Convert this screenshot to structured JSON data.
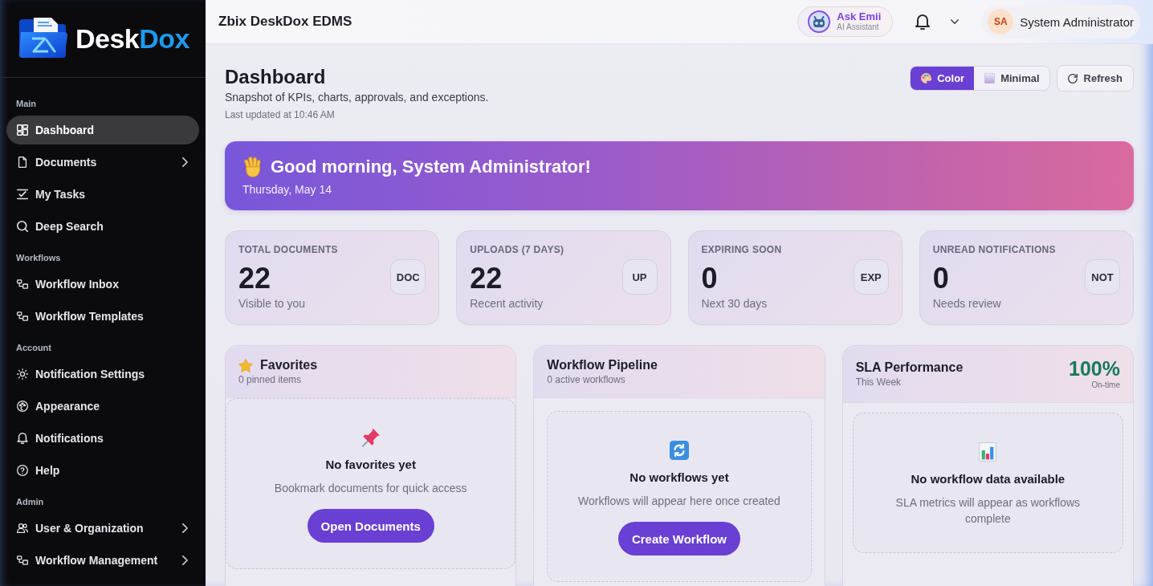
{
  "sidebar": {
    "brand": {
      "primary": "Desk",
      "accent": "Dox"
    },
    "sections": [
      {
        "label": "Main",
        "items": [
          {
            "label": "Dashboard",
            "selected": true,
            "expandable": false
          },
          {
            "label": "Documents",
            "selected": false,
            "expandable": true
          },
          {
            "label": "My Tasks",
            "selected": false,
            "expandable": false
          },
          {
            "label": "Deep Search",
            "selected": false,
            "expandable": false
          }
        ]
      },
      {
        "label": "Workflows",
        "items": [
          {
            "label": "Workflow Inbox",
            "selected": false,
            "expandable": false
          },
          {
            "label": "Workflow Templates",
            "selected": false,
            "expandable": false
          }
        ]
      },
      {
        "label": "Account",
        "items": [
          {
            "label": "Notification Settings",
            "selected": false,
            "expandable": false
          },
          {
            "label": "Appearance",
            "selected": false,
            "expandable": false
          },
          {
            "label": "Notifications",
            "selected": false,
            "expandable": false
          },
          {
            "label": "Help",
            "selected": false,
            "expandable": false
          }
        ]
      },
      {
        "label": "Admin",
        "items": [
          {
            "label": "User & Organization",
            "selected": false,
            "expandable": true
          },
          {
            "label": "Workflow Management",
            "selected": false,
            "expandable": true
          }
        ]
      }
    ]
  },
  "top_bar": {
    "title": "Zbix DeskDox EDMS",
    "assistant": {
      "name": "Ask Emii",
      "caption": "AI Assistant"
    },
    "user": {
      "initials": "SA",
      "name": "System Administrator"
    }
  },
  "header": {
    "title": "Dashboard",
    "subtitle": "Snapshot of KPIs, charts, approvals, and exceptions.",
    "updated": "Last updated at 10:46 AM",
    "view_modes": [
      {
        "label": "Color",
        "selected": true
      },
      {
        "label": "Minimal",
        "selected": false
      }
    ],
    "refresh": "Refresh"
  },
  "greeting": {
    "title": "Good morning, System Administrator!",
    "date": "Thursday, May 14"
  },
  "stats": [
    {
      "label": "TOTAL DOCUMENTS",
      "value": "22",
      "caption": "Visible to you",
      "badge": "DOC"
    },
    {
      "label": "UPLOADS (7 DAYS)",
      "value": "22",
      "caption": "Recent activity",
      "badge": "UP"
    },
    {
      "label": "EXPIRING SOON",
      "value": "0",
      "caption": "Next 30 days",
      "badge": "EXP"
    },
    {
      "label": "UNREAD NOTIFICATIONS",
      "value": "0",
      "caption": "Needs review",
      "badge": "NOT"
    }
  ],
  "panels": [
    {
      "title": "Favorites",
      "subtitle": "0 pinned items",
      "empty": {
        "title": "No favorites yet",
        "text": "Bookmark documents for quick access",
        "action": "Open Documents"
      }
    },
    {
      "title": "Workflow Pipeline",
      "subtitle": "0 active workflows",
      "empty": {
        "title": "No workflows yet",
        "text": "Workflows will appear here once created",
        "action": "Create Workflow"
      }
    },
    {
      "title": "SLA Performance",
      "subtitle": "This Week",
      "metric": {
        "value": "100%",
        "caption": "On-time"
      },
      "empty": {
        "title": "No workflow data available",
        "text": "SLA metrics will appear as workflows complete"
      }
    }
  ]
}
